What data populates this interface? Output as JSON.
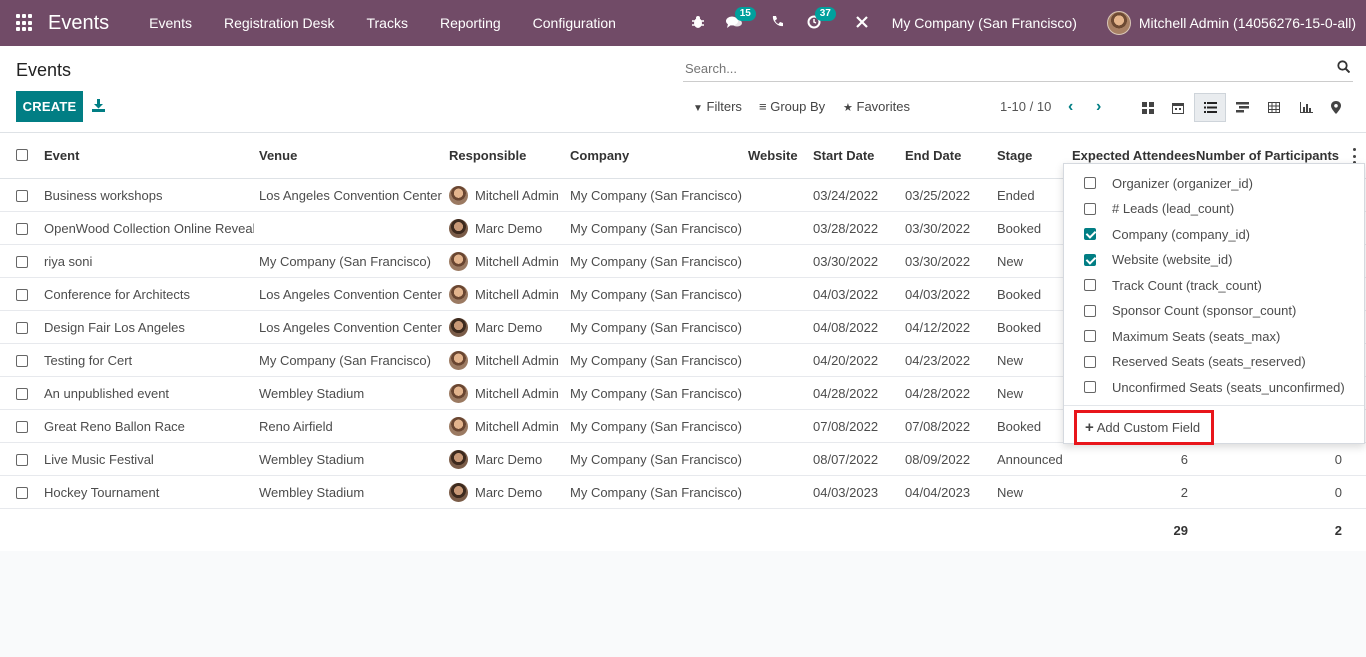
{
  "nav": {
    "brand": "Events",
    "menu": [
      "Events",
      "Registration Desk",
      "Tracks",
      "Reporting",
      "Configuration"
    ],
    "messages_badge": "15",
    "activities_badge": "37",
    "company": "My Company (San Francisco)",
    "user": "Mitchell Admin (14056276-15-0-all)"
  },
  "control": {
    "title": "Events",
    "create_label": "CREATE",
    "search_placeholder": "Search...",
    "filters_label": "Filters",
    "groupby_label": "Group By",
    "favorites_label": "Favorites",
    "pager": "1-10 / 10"
  },
  "table": {
    "headers": [
      "Event",
      "Venue",
      "Responsible",
      "Company",
      "Website",
      "Start Date",
      "End Date",
      "Stage",
      "Expected Attendees",
      "Number of Participants"
    ],
    "rows": [
      {
        "event": "Business workshops",
        "venue": "Los Angeles Convention Center",
        "responsible": "Mitchell Admin",
        "company": "My Company (San Francisco)",
        "start": "03/24/2022",
        "end": "03/25/2022",
        "stage": "Ended",
        "expected": "",
        "participants": ""
      },
      {
        "event": "OpenWood Collection Online Reveal",
        "venue": "",
        "responsible": "Marc Demo",
        "company": "My Company (San Francisco)",
        "start": "03/28/2022",
        "end": "03/30/2022",
        "stage": "Booked",
        "expected": "",
        "participants": ""
      },
      {
        "event": "riya soni",
        "venue": "My Company (San Francisco)",
        "responsible": "Mitchell Admin",
        "company": "My Company (San Francisco)",
        "start": "03/30/2022",
        "end": "03/30/2022",
        "stage": "New",
        "expected": "",
        "participants": ""
      },
      {
        "event": "Conference for Architects",
        "venue": "Los Angeles Convention Center",
        "responsible": "Mitchell Admin",
        "company": "My Company (San Francisco)",
        "start": "04/03/2022",
        "end": "04/03/2022",
        "stage": "Booked",
        "expected": "",
        "participants": ""
      },
      {
        "event": "Design Fair Los Angeles",
        "venue": "Los Angeles Convention Center",
        "responsible": "Marc Demo",
        "company": "My Company (San Francisco)",
        "start": "04/08/2022",
        "end": "04/12/2022",
        "stage": "Booked",
        "expected": "",
        "participants": ""
      },
      {
        "event": "Testing for Cert",
        "venue": "My Company (San Francisco)",
        "responsible": "Mitchell Admin",
        "company": "My Company (San Francisco)",
        "start": "04/20/2022",
        "end": "04/23/2022",
        "stage": "New",
        "expected": "",
        "participants": ""
      },
      {
        "event": "An unpublished event",
        "venue": "Wembley Stadium",
        "responsible": "Mitchell Admin",
        "company": "My Company (San Francisco)",
        "start": "04/28/2022",
        "end": "04/28/2022",
        "stage": "New",
        "expected": "",
        "participants": ""
      },
      {
        "event": "Great Reno Ballon Race",
        "venue": "Reno Airfield",
        "responsible": "Mitchell Admin",
        "company": "My Company (San Francisco)",
        "start": "07/08/2022",
        "end": "07/08/2022",
        "stage": "Booked",
        "expected": "",
        "participants": ""
      },
      {
        "event": "Live Music Festival",
        "venue": "Wembley Stadium",
        "responsible": "Marc Demo",
        "company": "My Company (San Francisco)",
        "start": "08/07/2022",
        "end": "08/09/2022",
        "stage": "Announced",
        "expected": "6",
        "participants": "0"
      },
      {
        "event": "Hockey Tournament",
        "venue": "Wembley Stadium",
        "responsible": "Marc Demo",
        "company": "My Company (San Francisco)",
        "start": "04/03/2023",
        "end": "04/04/2023",
        "stage": "New",
        "expected": "2",
        "participants": "0"
      }
    ],
    "totals": {
      "expected": "29",
      "participants": "2"
    }
  },
  "optional_columns": {
    "items": [
      {
        "label": "Organizer (organizer_id)",
        "checked": false
      },
      {
        "label": "# Leads (lead_count)",
        "checked": false
      },
      {
        "label": "Company (company_id)",
        "checked": true
      },
      {
        "label": "Website (website_id)",
        "checked": true
      },
      {
        "label": "Track Count (track_count)",
        "checked": false
      },
      {
        "label": "Sponsor Count (sponsor_count)",
        "checked": false
      },
      {
        "label": "Maximum Seats (seats_max)",
        "checked": false
      },
      {
        "label": "Reserved Seats (seats_reserved)",
        "checked": false
      },
      {
        "label": "Unconfirmed Seats (seats_unconfirmed)",
        "checked": false
      }
    ],
    "add_custom_field": "Add Custom Field"
  },
  "colors": {
    "nav_bg": "#714b67",
    "primary": "#017e84",
    "highlight": "#e8151b"
  }
}
